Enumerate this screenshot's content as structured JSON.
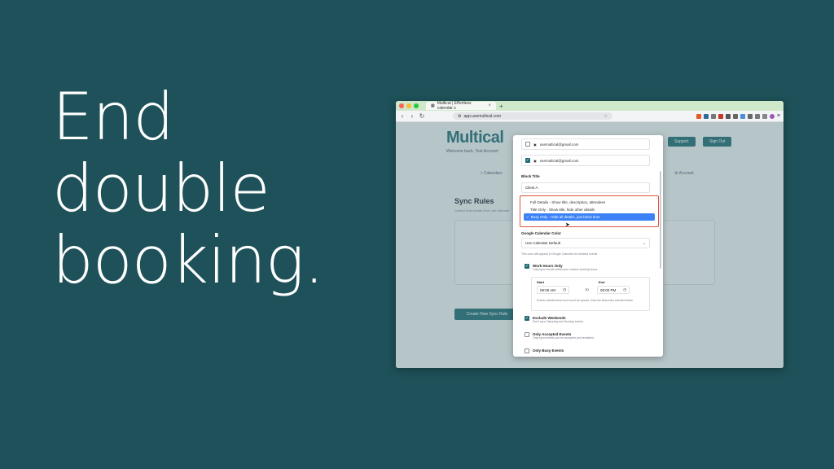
{
  "headline": {
    "line1": "End",
    "line2": "double",
    "line3": "booking."
  },
  "browser": {
    "tab_title": "Multical | Effortless calendar s",
    "tab_close": "×",
    "new_tab": "+",
    "url": "app.usemultical.com",
    "back": "‹",
    "forward": "›",
    "reload": "↻"
  },
  "app": {
    "logo": "Multical",
    "welcome": "Welcome back, Test Account",
    "support_label": "Support",
    "signout_label": "Sign Out",
    "nav_calendars": "Calendars",
    "nav_account": "Account",
    "rules_title": "Sync Rules",
    "rules_subtitle": "Control how events from one calendar",
    "create_rule_label": "Create New Sync Rule"
  },
  "modal": {
    "calendar1": "usemultical@gmail.com",
    "calendar2": "usemultical@gmail.com",
    "block_title_label": "Block Title",
    "block_title_value": "Client A",
    "dropdown_options": [
      "Full Details - Show title, description, attendees",
      "Title Only - Show title, hide other details",
      "Busy Only - Hide all details, just block time"
    ],
    "selected_check": "✓",
    "google_color_label": "Google Calendar Color",
    "google_color_value": "Use Calendar Default",
    "color_help": "This color will appear in Google Calendar for blocked events",
    "work_hours_title": "Work Hours Only",
    "work_hours_desc": "Only sync events within your custom working hours",
    "start_label": "Start",
    "end_label": "End",
    "start_value": "09:00 AM",
    "end_value": "05:00 PM",
    "to_label": "to",
    "time_note": "Events outside these hours won't be synced. Uses the timezones selected below.",
    "weekends_title": "Exclude Weekends",
    "weekends_desc": "Don't sync Saturday and Sunday events",
    "accepted_title": "Only Accepted Events",
    "accepted_desc": "Only sync events you've accepted (not tentative)",
    "busy_title": "Only Busy Events"
  },
  "colors": {
    "background": "#1e5159",
    "accent": "#1e6b73",
    "highlight": "#e0523a",
    "selection": "#3b82f6"
  }
}
